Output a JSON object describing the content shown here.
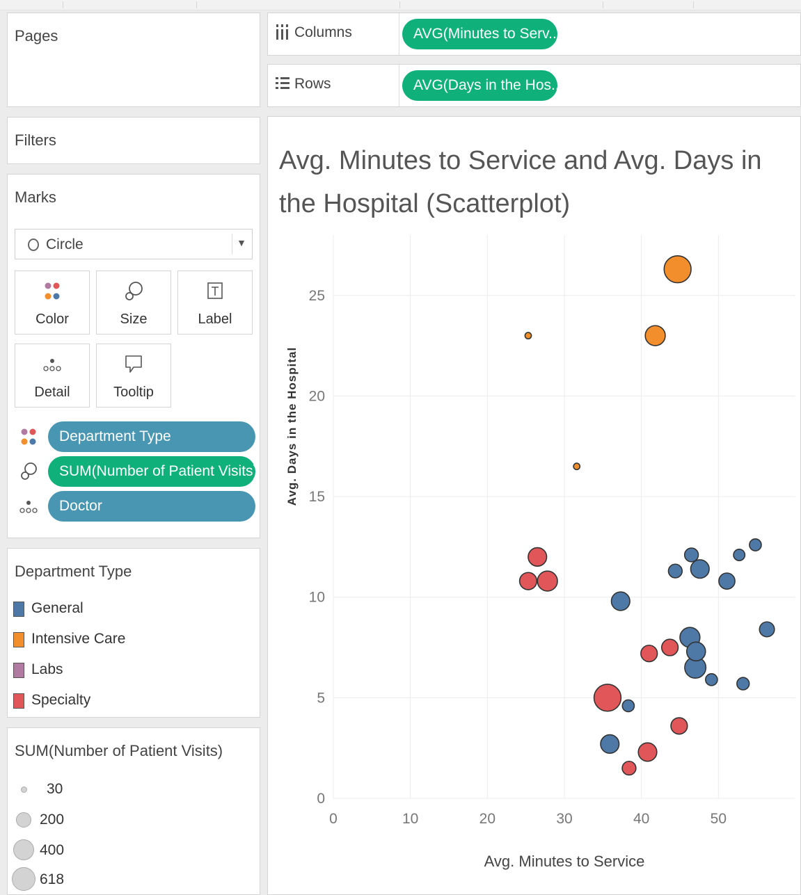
{
  "panels": {
    "pages_title": "Pages",
    "filters_title": "Filters",
    "marks_title": "Marks"
  },
  "marks": {
    "type": "Circle",
    "buttons": {
      "color": "Color",
      "size": "Size",
      "label": "Label",
      "detail": "Detail",
      "tooltip": "Tooltip"
    },
    "pills": {
      "color": "Department Type",
      "size": "SUM(Number of Patient Visits)",
      "detail": "Doctor"
    }
  },
  "color_legend": {
    "title": "Department Type",
    "items": [
      {
        "label": "General",
        "color": "#4e79a7"
      },
      {
        "label": "Intensive Care",
        "color": "#f28e2b"
      },
      {
        "label": "Labs",
        "color": "#b07aa1"
      },
      {
        "label": "Specialty",
        "color": "#e15759"
      }
    ]
  },
  "size_legend": {
    "title": "SUM(Number of Patient Visits)",
    "items": [
      {
        "label": "30",
        "value": 30
      },
      {
        "label": "200",
        "value": 200
      },
      {
        "label": "400",
        "value": 400
      },
      {
        "label": "618",
        "value": 618
      }
    ]
  },
  "shelves": {
    "columns": {
      "label": "Columns",
      "pill": "AVG(Minutes to Serv.."
    },
    "rows": {
      "label": "Rows",
      "pill": "AVG(Days in the Hos.."
    }
  },
  "chart_data": {
    "type": "scatter",
    "title": "Avg. Minutes to Service and Avg. Days in the Hospital (Scatterplot)",
    "xlabel": "Avg. Minutes to Service",
    "ylabel": "Avg. Days in the Hospital",
    "xlim": [
      0,
      60
    ],
    "ylim": [
      0,
      28
    ],
    "x_ticks": [
      0,
      10,
      20,
      30,
      40,
      50
    ],
    "y_ticks": [
      0,
      5,
      10,
      15,
      20,
      25
    ],
    "grid": true,
    "series": [
      {
        "name": "General",
        "color": "#4e79a7",
        "points": [
          {
            "x": 37.3,
            "y": 9.8,
            "size": 290
          },
          {
            "x": 44.4,
            "y": 11.3,
            "size": 160
          },
          {
            "x": 46.5,
            "y": 12.1,
            "size": 160
          },
          {
            "x": 47.6,
            "y": 11.4,
            "size": 290
          },
          {
            "x": 51.1,
            "y": 10.8,
            "size": 220
          },
          {
            "x": 52.7,
            "y": 12.1,
            "size": 110
          },
          {
            "x": 54.8,
            "y": 12.6,
            "size": 120
          },
          {
            "x": 46.3,
            "y": 8.0,
            "size": 340
          },
          {
            "x": 47.1,
            "y": 7.3,
            "size": 300
          },
          {
            "x": 47.0,
            "y": 6.5,
            "size": 380
          },
          {
            "x": 49.1,
            "y": 5.9,
            "size": 120
          },
          {
            "x": 53.2,
            "y": 5.7,
            "size": 130
          },
          {
            "x": 56.3,
            "y": 8.4,
            "size": 190
          },
          {
            "x": 38.3,
            "y": 4.6,
            "size": 120
          },
          {
            "x": 35.9,
            "y": 2.7,
            "size": 290
          }
        ]
      },
      {
        "name": "Intensive Care",
        "color": "#f28e2b",
        "points": [
          {
            "x": 44.7,
            "y": 26.3,
            "size": 618
          },
          {
            "x": 41.8,
            "y": 23.0,
            "size": 340
          },
          {
            "x": 25.3,
            "y": 23.0,
            "size": 35
          },
          {
            "x": 31.6,
            "y": 16.5,
            "size": 35
          }
        ]
      },
      {
        "name": "Specialty",
        "color": "#e15759",
        "points": [
          {
            "x": 26.5,
            "y": 12.0,
            "size": 290
          },
          {
            "x": 25.3,
            "y": 10.8,
            "size": 250
          },
          {
            "x": 27.8,
            "y": 10.8,
            "size": 340
          },
          {
            "x": 35.6,
            "y": 5.0,
            "size": 618
          },
          {
            "x": 41.0,
            "y": 7.2,
            "size": 230
          },
          {
            "x": 43.7,
            "y": 7.5,
            "size": 230
          },
          {
            "x": 44.9,
            "y": 3.6,
            "size": 230
          },
          {
            "x": 40.8,
            "y": 2.3,
            "size": 290
          },
          {
            "x": 38.4,
            "y": 1.5,
            "size": 160
          }
        ]
      }
    ]
  }
}
